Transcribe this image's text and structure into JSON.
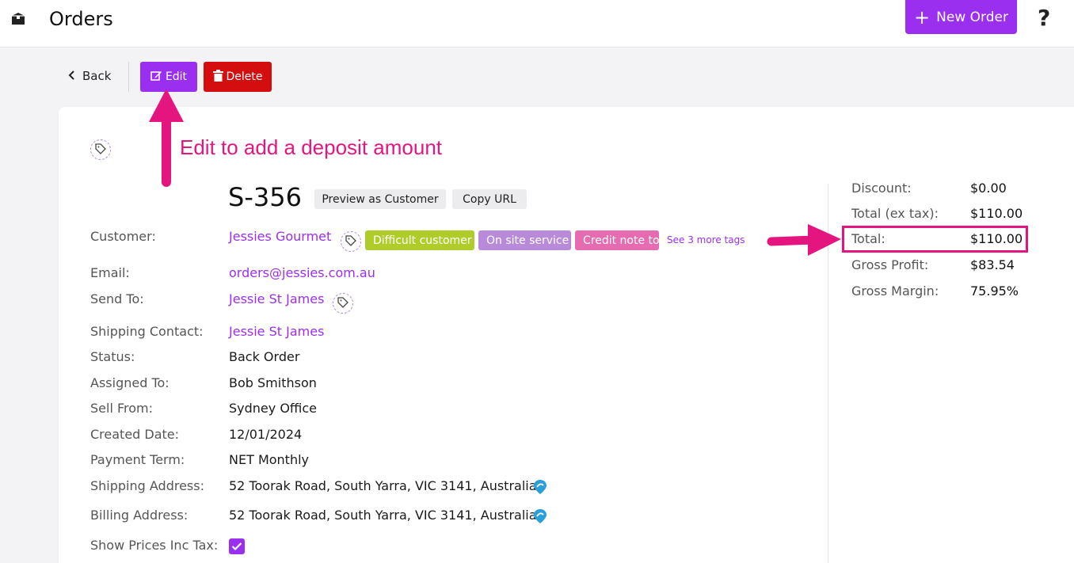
{
  "header": {
    "title": "Orders",
    "new_order_label": "New Order",
    "help_glyph": "?"
  },
  "actions": {
    "back_label": "Back",
    "edit_label": "Edit",
    "delete_label": "Delete"
  },
  "annotation": {
    "text": "Edit to add a deposit amount",
    "color": "#e5157f"
  },
  "order": {
    "number": "S-356",
    "preview_label": "Preview as Customer",
    "copy_url_label": "Copy URL",
    "fields": {
      "customer": {
        "label": "Customer:",
        "value": "Jessies Gourmet"
      },
      "email": {
        "label": "Email:",
        "value": "orders@jessies.com.au"
      },
      "send_to": {
        "label": "Send To:",
        "value": "Jessie St James"
      },
      "shipping_contact": {
        "label": "Shipping Contact:",
        "value": "Jessie St James"
      },
      "status": {
        "label": "Status:",
        "value": "Back Order"
      },
      "assigned_to": {
        "label": "Assigned To:",
        "value": "Bob Smithson"
      },
      "sell_from": {
        "label": "Sell From:",
        "value": "Sydney Office"
      },
      "created_date": {
        "label": "Created Date:",
        "value": "12/01/2024"
      },
      "payment_term": {
        "label": "Payment Term:",
        "value": "NET Monthly"
      },
      "shipping_address": {
        "label": "Shipping Address:",
        "value": "52 Toorak Road, South Yarra, VIC 3141, Australia"
      },
      "billing_address": {
        "label": "Billing Address:",
        "value": "52 Toorak Road, South Yarra, VIC 3141, Australia"
      },
      "show_prices_inc_tax": {
        "label": "Show Prices Inc Tax:",
        "checked": true
      }
    },
    "tags": [
      {
        "label": "Difficult customer",
        "color": "#b0cc2a"
      },
      {
        "label": "On site service",
        "color": "#b98ad9"
      },
      {
        "label": "Credit note to",
        "color": "#e66bb0"
      }
    ],
    "more_tags_label": "See 3 more tags"
  },
  "summary": {
    "discount": {
      "label": "Discount:",
      "value": "$0.00"
    },
    "total_ex_tax": {
      "label": "Total (ex tax):",
      "value": "$110.00"
    },
    "total": {
      "label": "Total:",
      "value": "$110.00"
    },
    "gross_profit": {
      "label": "Gross Profit:",
      "value": "$83.54"
    },
    "gross_margin": {
      "label": "Gross Margin:",
      "value": "75.95%"
    }
  },
  "colors": {
    "accent": "#9b2ff0",
    "danger": "#d40e0e",
    "highlight": "#e5157f"
  },
  "icons": [
    "box-icon",
    "plus-icon",
    "question-icon",
    "chevron-left-icon",
    "edit-icon",
    "trash-icon",
    "tag-icon",
    "map-pin-icon",
    "check-icon",
    "arrow-up-icon",
    "arrow-right-icon"
  ]
}
